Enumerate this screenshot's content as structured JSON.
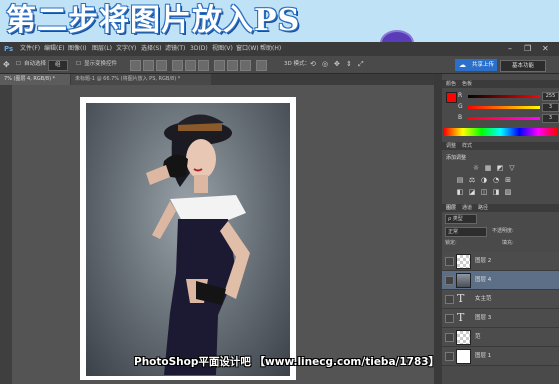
{
  "banner": {
    "title": "第二步将图片放入PS"
  },
  "menubar": {
    "items": [
      "文件(F)",
      "编辑(E)",
      "图像(I)",
      "图层(L)",
      "文字(Y)",
      "选择(S)",
      "滤镜(T)",
      "3D(D)",
      "视图(V)",
      "窗口(W)",
      "帮助(H)"
    ],
    "window_controls": [
      "–",
      "❐",
      "✕"
    ]
  },
  "options_bar": {
    "auto_select_label": "自动选择",
    "auto_select_value": "组",
    "show_transform_label": "显示变换控件",
    "mode_3d_label": "3D 模式：",
    "share_label": "共享上传",
    "workspace_label": "基本功能"
  },
  "tabs": {
    "tab1": "7% (图层 4, RGB/8) *",
    "tab2": "未标题-1 @ 66.7% (将图片放入 PS, RGB/8) *"
  },
  "watermark": {
    "text": "PhotoShop平面设计吧 【www.linecg.com/tieba/1783】"
  },
  "panels": {
    "color_tabs": [
      "颜色",
      "色板"
    ],
    "color": {
      "labels": [
        "R",
        "G",
        "B"
      ],
      "values": [
        "255",
        "3",
        "3"
      ],
      "foreground": "#ff0303",
      "background": "#ffffff"
    },
    "adjust_tabs": [
      "调整",
      "样式"
    ],
    "adjust_title": "添加调整",
    "adjust_icons_row1": [
      "☼",
      "▦",
      "◩",
      "▽"
    ],
    "adjust_icons_row2": [
      "▤",
      "⚖",
      "◑",
      "◔",
      "⊞"
    ],
    "adjust_icons_row3": [
      "◧",
      "◪",
      "◫",
      "◨",
      "▨"
    ],
    "layer_tabs": [
      "图层",
      "通道",
      "路径"
    ],
    "filter_label": "ρ 类型",
    "blend_mode": "正常",
    "opacity_label": "不透明度:",
    "lock_label": "锁定:",
    "fill_label": "填充:",
    "layers": [
      {
        "name": "图层 2",
        "type": "pixel",
        "selected": false
      },
      {
        "name": "图层 4",
        "type": "photo",
        "selected": true
      },
      {
        "name": "女主范",
        "type": "text",
        "selected": false
      },
      {
        "name": "图层 3",
        "type": "text",
        "selected": false
      },
      {
        "name": "范",
        "type": "pixel",
        "selected": false
      },
      {
        "name": "图层 1",
        "type": "white",
        "selected": false
      }
    ]
  },
  "colors": {
    "accent": "#2a6fc9",
    "banner": "#bfe2f6"
  }
}
